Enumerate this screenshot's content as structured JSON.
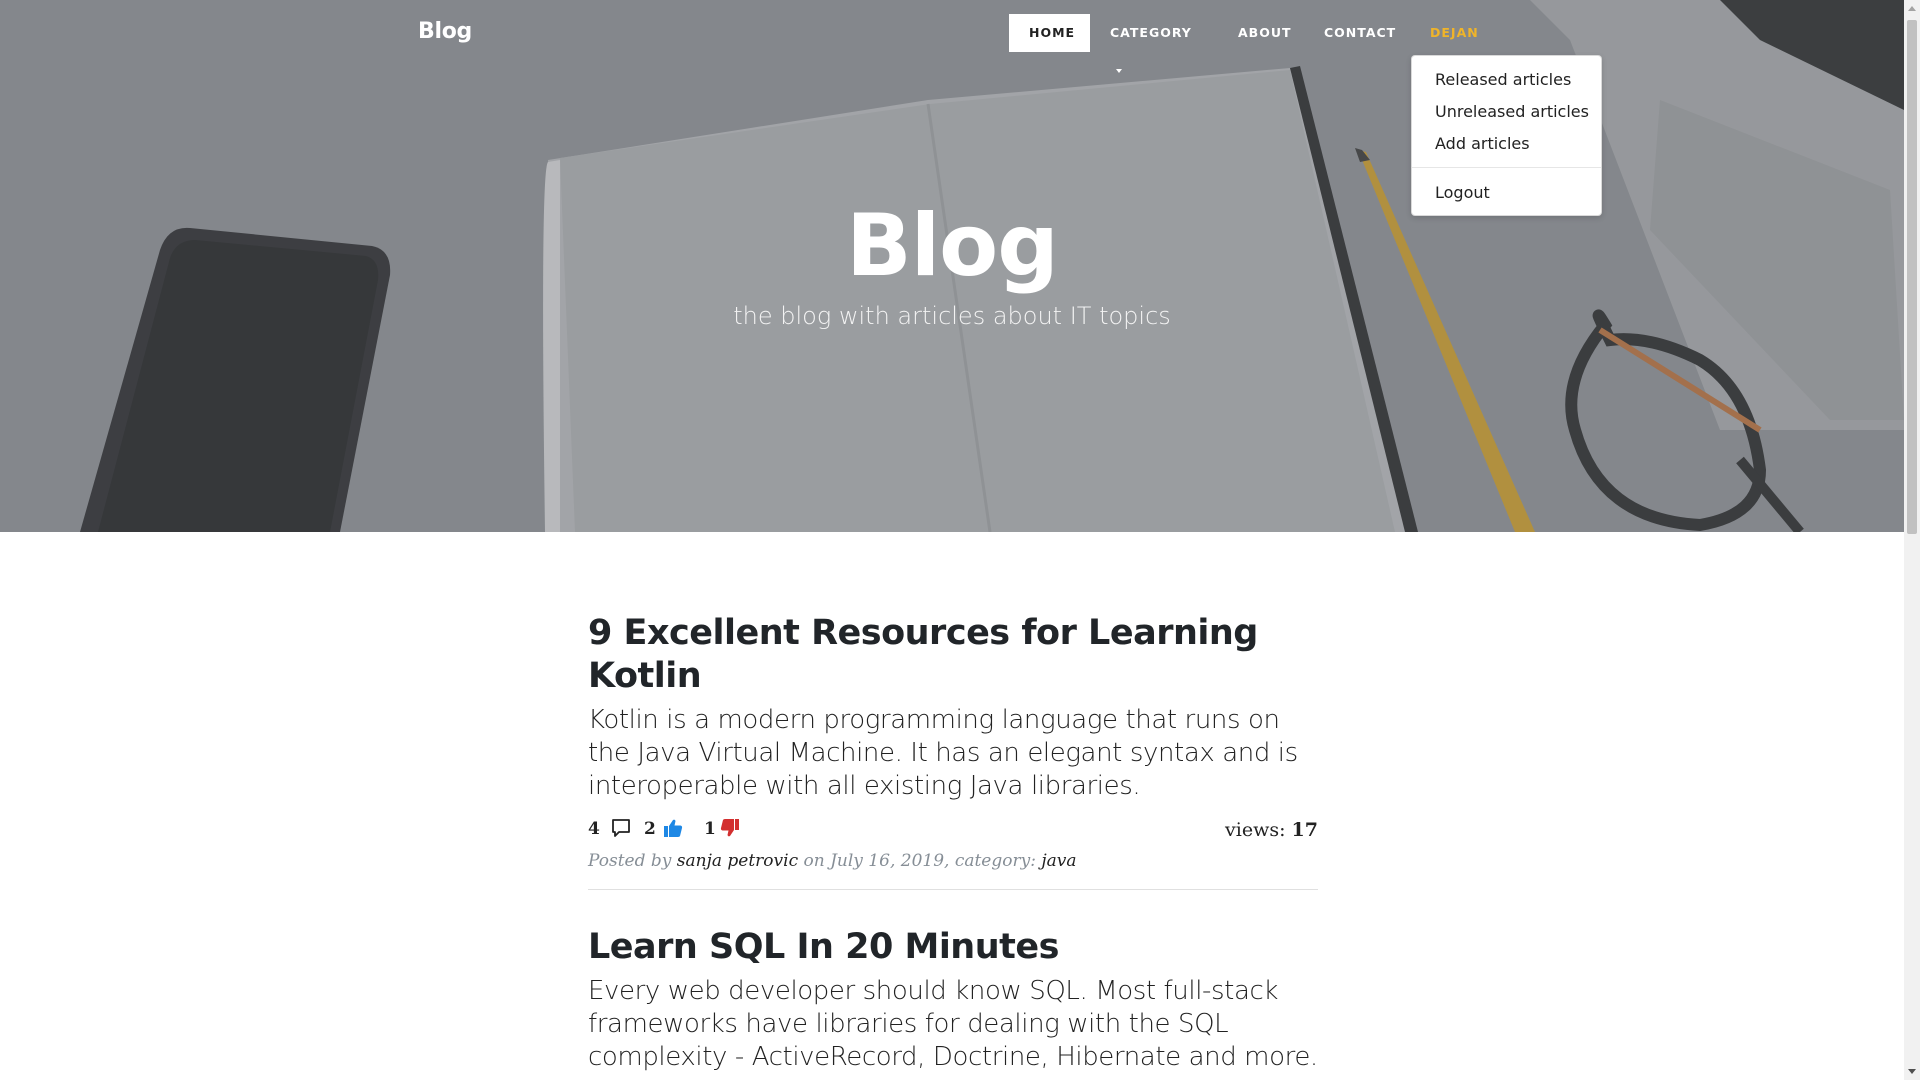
{
  "nav": {
    "brand": "Blog",
    "items": [
      {
        "label": "HOME"
      },
      {
        "label": "CATEGORY"
      },
      {
        "label": "ABOUT"
      },
      {
        "label": "CONTACT"
      },
      {
        "label": "DEJAN"
      }
    ],
    "user_color": "#f0b429"
  },
  "user_menu": {
    "items": [
      "Released articles",
      "Unreleased articles",
      "Add articles"
    ],
    "logout": "Logout"
  },
  "hero": {
    "title": "Blog",
    "subtitle": "the blog with articles about IT topics"
  },
  "posts": [
    {
      "title": "9 Excellent Resources for Learning Kotlin",
      "subtitle": "Kotlin is a modern programming language that runs on the Java Virtual Machine. It has an elegant syntax and is interoperable with all existing Java libraries.",
      "comments": "4",
      "likes": "2",
      "dislikes": "1",
      "views_label": "views:",
      "views": "17",
      "posted_by": "Posted by",
      "author": "sanja petrovic",
      "date_text": "on July 16, 2019, category:",
      "category": "java"
    },
    {
      "title": "Learn SQL In 20 Minutes",
      "subtitle": "Every web developer should know SQL. Most full-stack frameworks have libraries for dealing with the SQL complexity - ActiveRecord, Doctrine, Hibernate and more."
    }
  ],
  "colors": {
    "like": "#1e88e5",
    "dislike": "#d32f2f",
    "accent": "#f0b429"
  }
}
